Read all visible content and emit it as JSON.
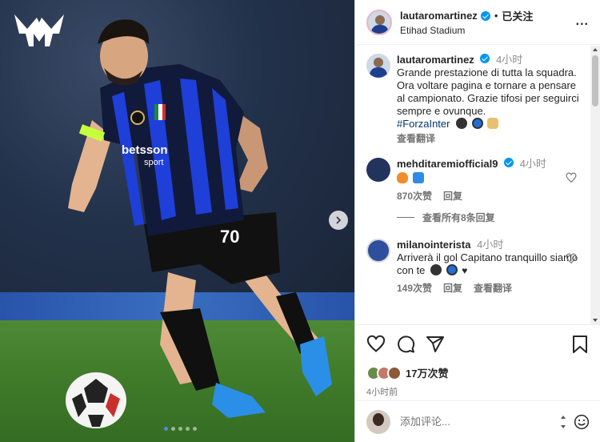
{
  "header": {
    "username": "lautaromartinez",
    "separator": "•",
    "follow_status": "已关注",
    "location": "Etihad Stadium",
    "more_label": "..."
  },
  "caption": {
    "username": "lautaromartinez",
    "time": "4小时",
    "text": "Grande prestazione di tutta la squadra.\nOra voltare pagina e tornare a pensare al campionato. Grazie tifosi per seguirci sempre e ovunque.",
    "hashtag": "#ForzaInter",
    "translate": "查看翻译"
  },
  "comments": [
    {
      "username": "mehditaremiofficial9",
      "time": "4小时",
      "likes": "870次赞",
      "reply": "回复"
    },
    {
      "username": "milanointerista",
      "time": "4小时",
      "text": "Arriverà il gol Capitano tranquillo siamo con te",
      "likes": "149次赞",
      "reply": "回复",
      "translate": "查看翻译"
    }
  ],
  "view_replies": "查看所有8条回复",
  "likes_summary": "17万次赞",
  "posted_time": "4小时前",
  "add_comment": {
    "placeholder": "添加评论..."
  },
  "player": {
    "shirt_number": "70",
    "sponsor": "betsson",
    "sponsor_sub": "sport"
  },
  "colors": {
    "verified": "#0095f6",
    "inter_blue": "#1f3fd9",
    "link": "#00376b"
  }
}
